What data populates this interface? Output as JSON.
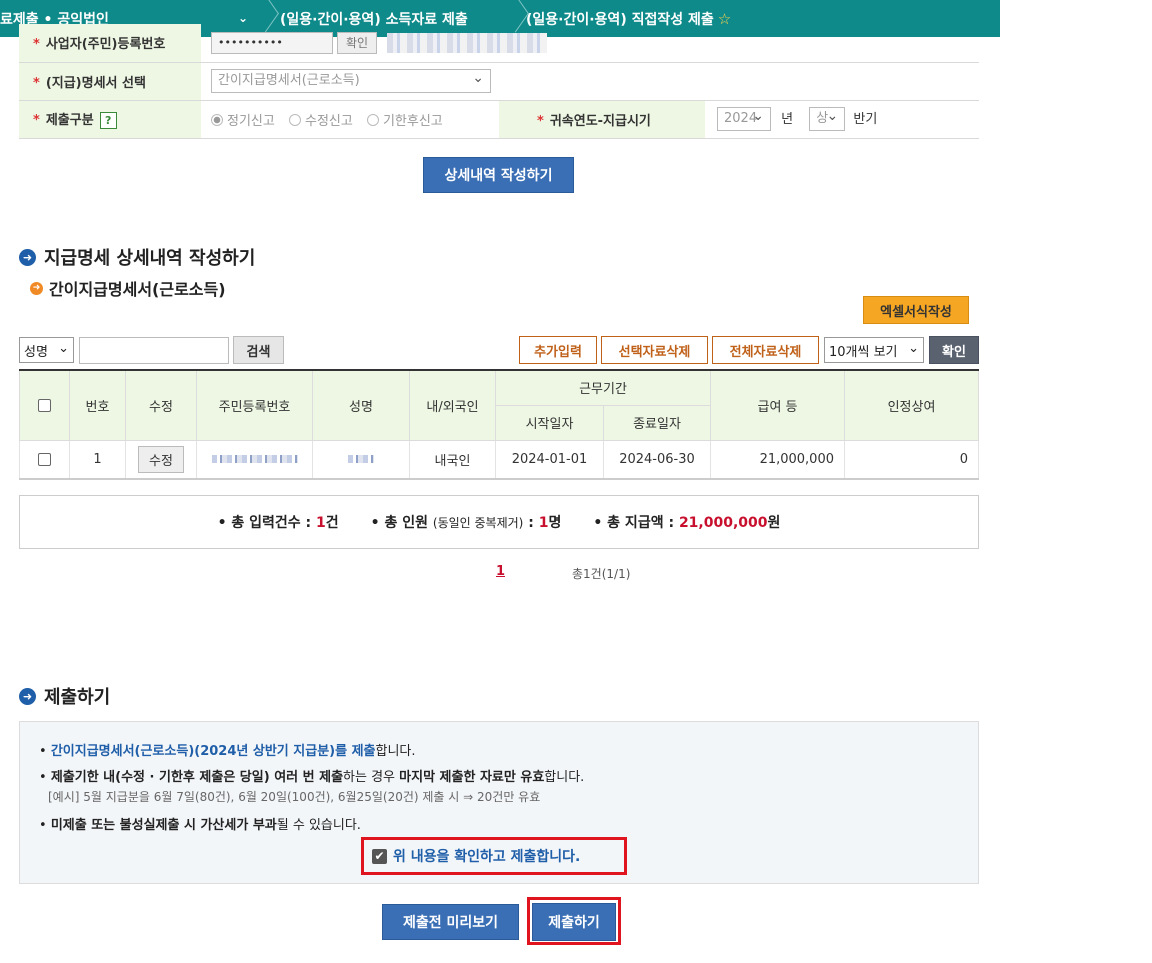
{
  "nav": {
    "crumb1": "료제출 • 공익법인",
    "crumb2": "(일용·간이·용역) 소득자료 제출",
    "crumb3": "(일용·간이·용역) 직접작성 제출",
    "star_glyph": "☆",
    "chevron_glyph": "⌄"
  },
  "form": {
    "req_mark": "*",
    "bizno_label": "사업자(주민)등록번호",
    "bizno_value": "••••••••••",
    "confirm_btn": "확인",
    "doc_label": "(지급)명세서 선택",
    "doc_value": "간이지급명세서(근로소득)",
    "submit_type_label": "제출구분",
    "help_glyph": "?",
    "radio1": "정기신고",
    "radio2": "수정신고",
    "radio3": "기한후신고",
    "year_label": "귀속연도-지급시기",
    "year_value": "2024",
    "year_unit": "년",
    "half_value": "상",
    "half_unit": "반기"
  },
  "detail_btn": "상세내역 작성하기",
  "section1": {
    "title": "지급명세 상세내역 작성하기",
    "subtitle": "간이지급명세서(근로소득)",
    "arrow_glyph": "➜",
    "excel_btn": "엑셀서식작성"
  },
  "search": {
    "field_value": "성명",
    "search_btn": "검색",
    "add_btn": "추가입력",
    "del_sel_btn": "선택자료삭제",
    "del_all_btn": "전체자료삭제",
    "page_size": "10개씩 보기",
    "confirm_btn": "확인"
  },
  "table": {
    "headers": {
      "no": "번호",
      "edit": "수정",
      "rrn": "주민등록번호",
      "name": "성명",
      "nat": "내/외국인",
      "period": "근무기간",
      "start": "시작일자",
      "end": "종료일자",
      "pay": "급여 등",
      "bonus": "인정상여"
    },
    "rows": [
      {
        "no": "1",
        "edit_btn": "수정",
        "nationality": "내국인",
        "start": "2024-01-01",
        "end": "2024-06-30",
        "pay": "21,000,000",
        "bonus": "0"
      }
    ]
  },
  "summary": {
    "count_label": "• 총 입력건수 : ",
    "count_value": "1",
    "count_unit": "건",
    "people_label": "• 총 인원 ",
    "people_note": "(동일인 중복제거)",
    "people_sep": " : ",
    "people_value": "1",
    "people_unit": "명",
    "amount_label": "• 총 지급액 : ",
    "amount_value": "21,000,000",
    "amount_unit": "원"
  },
  "pager": {
    "current": "1",
    "total": "총1건(1/1)"
  },
  "section2": {
    "title": "제출하기"
  },
  "info": {
    "l1_blue": "간이지급명세서(근로소득)(2024년 상반기 지급분)를 제출",
    "l1_tail": "합니다.",
    "l2_a": "제출기한 내(수정 · 기한후 제출은 당일) 여러 번 제출",
    "l2_b": "하는 경우 ",
    "l2_c": "마지막 제출한 자료만 유효",
    "l2_d": "합니다.",
    "l3": "[예시] 5월 지급분을 6월 7일(80건), 6월 20일(100건), 6월25일(20건) 제출 시 ⇒ 20건만 유효",
    "l4_a": "미제출 또는 불성실제출 시 가산세가 부과",
    "l4_b": "될 수 있습니다.",
    "bullet": "•"
  },
  "confirm_text": "위 내용을 확인하고 제출합니다.",
  "check_glyph": "✔",
  "preview_btn": "제출전 미리보기",
  "submit_btn": "제출하기"
}
